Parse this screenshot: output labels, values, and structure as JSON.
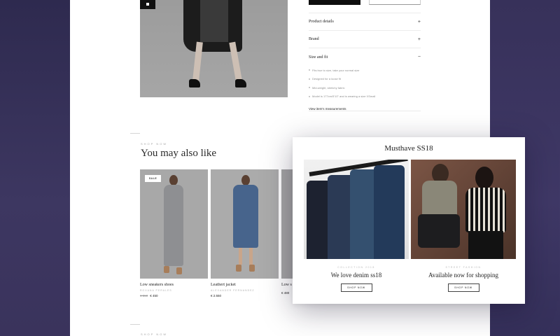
{
  "accordion": {
    "product_details": "Product details",
    "brand": "Brand",
    "size_and_fit": "Size and fit",
    "plus": "+",
    "minus": "−",
    "fit_items": [
      "Fits true to size, take your normal size",
      "Designed for a loose fit",
      "Mid-weight, stretchy fabric",
      "Model is 177cm/5'10\" and is wearing a size XSmall"
    ],
    "measurements_link": "View item's measurements"
  },
  "recommendations": {
    "kicker": "SHOP NOW",
    "title": "You may also like",
    "products": [
      {
        "badge": "SALE",
        "name": "Low sneakers shoes",
        "brand": "ROXANA PERALES",
        "old_price": "€ 550",
        "price": "€ 450"
      },
      {
        "name": "Leathert jacket",
        "brand": "ALEXANDER FERNANDEZ",
        "price": "€ 2.550"
      },
      {
        "name": "Low s",
        "brand": "",
        "price": "€ 480"
      }
    ]
  },
  "bottom_kicker": "SHOP NOW",
  "popup": {
    "title": "Musthave SS18",
    "promos": [
      {
        "kicker": "COLLECTION 2018",
        "title": "We love denim ss18",
        "button": "SHOP NOW"
      },
      {
        "kicker": "STREET FASHION",
        "title": "Available now for shopping",
        "button": "SHOP NOW"
      }
    ]
  },
  "colors": {
    "background": "#3a335c",
    "page": "#ffffff",
    "accent_dark": "#0e0e0e"
  }
}
